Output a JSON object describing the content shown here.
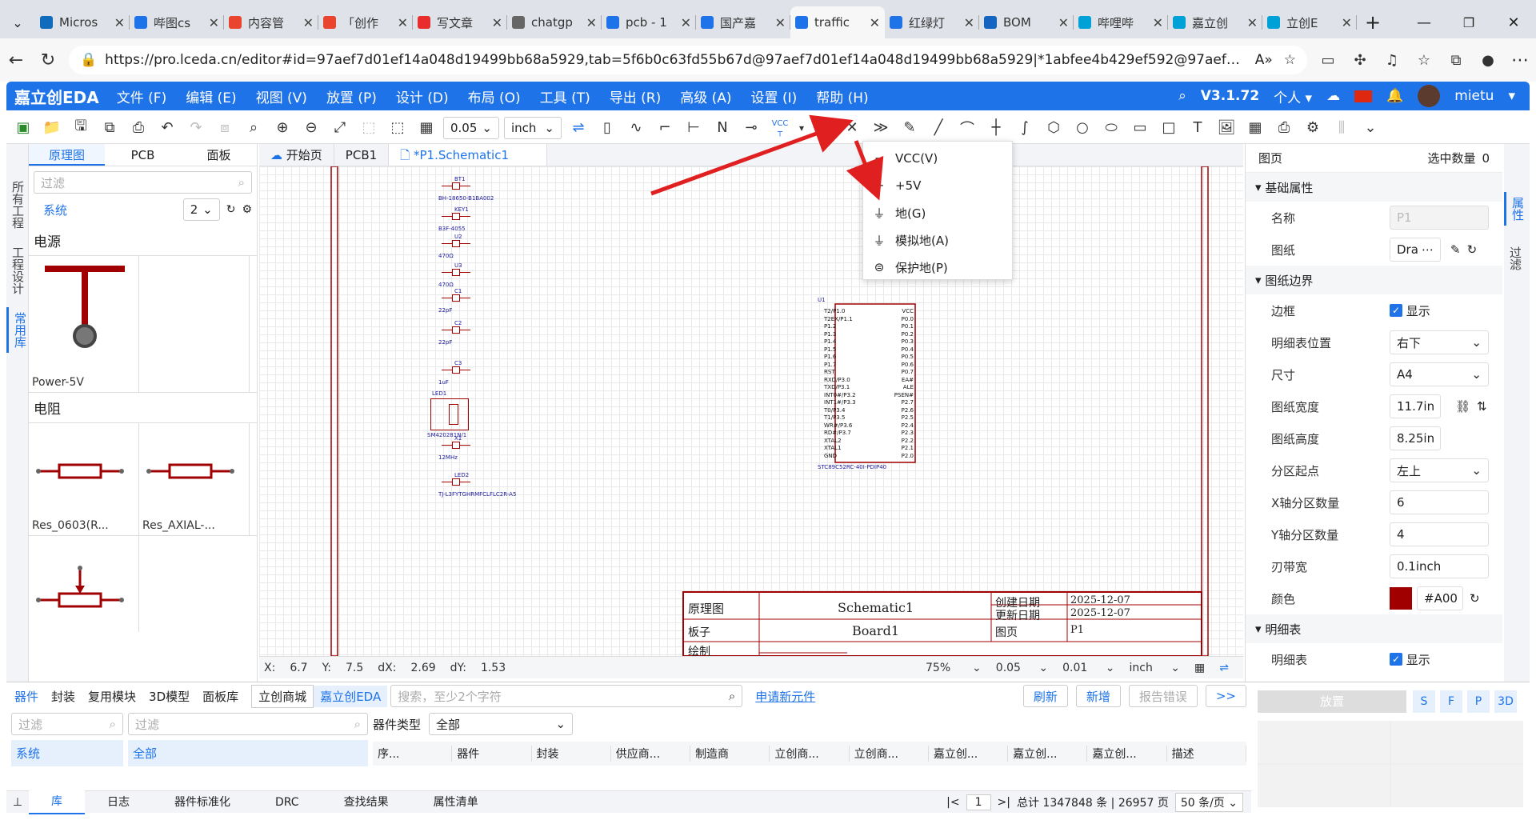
{
  "browser": {
    "tabs": [
      {
        "title": "Micros",
        "color": "#0f6cbd"
      },
      {
        "title": "哔图cs",
        "color": "#1e73e8"
      },
      {
        "title": "内容管",
        "color": "#e8442e"
      },
      {
        "title": "「创作",
        "color": "#e8442e"
      },
      {
        "title": "写文章",
        "color": "#e82d2d"
      },
      {
        "title": "chatgp",
        "color": "#666"
      },
      {
        "title": "pcb - 1",
        "color": "#1e73e8"
      },
      {
        "title": "国产嘉",
        "color": "#1e73e8"
      },
      {
        "title": "traffic",
        "color": "#1e73e8",
        "active": true
      },
      {
        "title": "红绿灯",
        "color": "#1e73e8"
      },
      {
        "title": "BOM",
        "color": "#1565c0"
      },
      {
        "title": "哔哩哔",
        "color": "#00a1d6"
      },
      {
        "title": "嘉立创",
        "color": "#00a1d6"
      },
      {
        "title": "立创E",
        "color": "#00a1d6"
      }
    ],
    "url": "https://pro.lceda.cn/editor#id=97aef7d01ef14a048d19499bb68a5929,tab=5f6b0c63fd55b67d@97aef7d01ef14a048d19499bb68a5929|*1abfee4b429ef592@97aef7d01ef14a048d19..."
  },
  "app": {
    "logo": "嘉立创EDA",
    "menus": [
      "文件 (F)",
      "编辑 (E)",
      "视图 (V)",
      "放置 (P)",
      "设计 (D)",
      "布局 (O)",
      "工具 (T)",
      "导出 (R)",
      "高级 (A)",
      "设置 (I)",
      "帮助 (H)"
    ],
    "version": "V3.1.72",
    "user_mode": "个人",
    "username": "mietu"
  },
  "toolbar": {
    "grid": "0.05",
    "unit": "inch",
    "vcc_label": "VCC"
  },
  "power_menu": [
    {
      "label": "VCC(V)",
      "icon": "vcc-icon"
    },
    {
      "label": "+5V",
      "icon": "plus5v-icon"
    },
    {
      "label": "地(G)",
      "icon": "ground-icon"
    },
    {
      "label": "模拟地(A)",
      "icon": "analog-ground-icon"
    },
    {
      "label": "保护地(P)",
      "icon": "protective-ground-icon"
    }
  ],
  "left_vtabs": [
    "所有工程",
    "工程设计",
    "常用库"
  ],
  "left_panel": {
    "tabs": [
      "原理图",
      "PCB",
      "面板"
    ],
    "filter_placeholder": "过滤",
    "system": "系统",
    "count": "2",
    "section_power": "电源",
    "power_item": "Power-5V",
    "section_res": "电阻",
    "res_items": [
      "Res_0603(R...",
      "Res_AXIAL-..."
    ]
  },
  "doc_tabs": [
    "开始页",
    "PCB1",
    "*P1.Schematic1"
  ],
  "schematic": {
    "parts": [
      {
        "ref": "BT1",
        "val": "BH-18650-B1BA002"
      },
      {
        "ref": "KEY1",
        "val": "B3F-4055"
      },
      {
        "ref": "U2",
        "val": "470Ω"
      },
      {
        "ref": "U3",
        "val": "470Ω"
      },
      {
        "ref": "C1",
        "val": "22pF"
      },
      {
        "ref": "C2",
        "val": "22pF"
      },
      {
        "ref": "C3",
        "val": "1uF"
      },
      {
        "ref": "LED1",
        "val": "SM420281N/1"
      },
      {
        "ref": "X1",
        "val": "12MHz"
      },
      {
        "ref": "LED2",
        "val": "TJ-L3FYTGHRMFCLFLC2R-A5"
      }
    ],
    "mcu": {
      "ref": "U1",
      "val": "STC89C52RC-40I-PDIP40",
      "left_pins": [
        "T2/P1.0",
        "T2EX/P1.1",
        "P1.2",
        "P1.3",
        "P1.4",
        "P1.5",
        "P1.6",
        "P1.7",
        "RST",
        "RXD/P3.0",
        "TXD/P3.1",
        "INT0#/P3.2",
        "INT1#/P3.3",
        "T0/P3.4",
        "T1/P3.5",
        "WR#/P3.6",
        "RD#/P3.7",
        "XTAL2",
        "XTAL1",
        "GND"
      ],
      "right_pins": [
        "VCC",
        "P0.0",
        "P0.1",
        "P0.2",
        "P0.3",
        "P0.4",
        "P0.5",
        "P0.6",
        "P0.7",
        "EA#",
        "ALE",
        "PSEN#",
        "P2.7",
        "P2.6",
        "P2.5",
        "P2.4",
        "P2.3",
        "P2.2",
        "P2.1",
        "P2.0"
      ]
    },
    "titleblock": {
      "r1": [
        "原理图",
        "Schematic1",
        "创建日期",
        "2025-12-07"
      ],
      "r2": [
        "更新日期",
        "2025-12-07"
      ],
      "r3": [
        "板子",
        "Board1",
        "图页",
        "P1"
      ],
      "r4": [
        "绘制"
      ]
    }
  },
  "status": {
    "x_label": "X:",
    "x": "6.7",
    "y_label": "Y:",
    "y": "7.5",
    "dx_label": "dX:",
    "dx": "2.69",
    "dy_label": "dY:",
    "dy": "1.53",
    "zoom": "75%",
    "grid1": "0.05",
    "grid2": "0.01",
    "unit": "inch"
  },
  "right_panel": {
    "title": "图页",
    "selected": "选中数量",
    "selected_count": "0",
    "sec_basic": "基础属性",
    "name_label": "名称",
    "name_val": "P1",
    "sheet_label": "图纸",
    "sheet_val": "Dra",
    "sec_border": "图纸边界",
    "border_label": "边框",
    "show": "显示",
    "titlepos_label": "明细表位置",
    "titlepos_val": "右下",
    "size_label": "尺寸",
    "size_val": "A4",
    "width_label": "图纸宽度",
    "width_val": "11.7in",
    "height_label": "图纸高度",
    "height_val": "8.25in",
    "zone_label": "分区起点",
    "zone_val": "左上",
    "xcount_label": "X轴分区数量",
    "xcount_val": "6",
    "ycount_label": "Y轴分区数量",
    "ycount_val": "4",
    "band_label": "刃带宽",
    "band_val": "0.1inch",
    "color_label": "颜色",
    "color_val": "#A00",
    "color_hex": "#a00000",
    "sec_table": "明细表",
    "table_label": "明细表",
    "table_show": "显示"
  },
  "right_vtabs": [
    "属性",
    "过滤"
  ],
  "bottom": {
    "tabs": [
      "器件",
      "封装",
      "复用模块",
      "3D模型",
      "面板库"
    ],
    "sources": [
      "立创商城",
      "嘉立创EDA"
    ],
    "search_placeholder": "搜索，至少2个字符",
    "apply_link": "申请新元件",
    "buttons": [
      "刷新",
      "新增",
      "报告错误",
      ">>"
    ],
    "filter1": "过滤",
    "filter2": "过滤",
    "system": "系统",
    "all": "全部",
    "type_label": "器件类型",
    "type_val": "全部",
    "columns": [
      "序...",
      "器件",
      "封装",
      "供应商...",
      "制造商",
      "立创商...",
      "立创商...",
      "嘉立创...",
      "嘉立创...",
      "嘉立创...",
      "描述"
    ],
    "place_btn": "放置",
    "letters": [
      "S",
      "F",
      "P",
      "3D"
    ],
    "bottom_tabs": [
      "库",
      "日志",
      "器件标准化",
      "DRC",
      "查找结果",
      "属性清单"
    ],
    "page": "1",
    "total": "总计 1347848 条 | 26957 页",
    "per_page": "50 条/页"
  }
}
